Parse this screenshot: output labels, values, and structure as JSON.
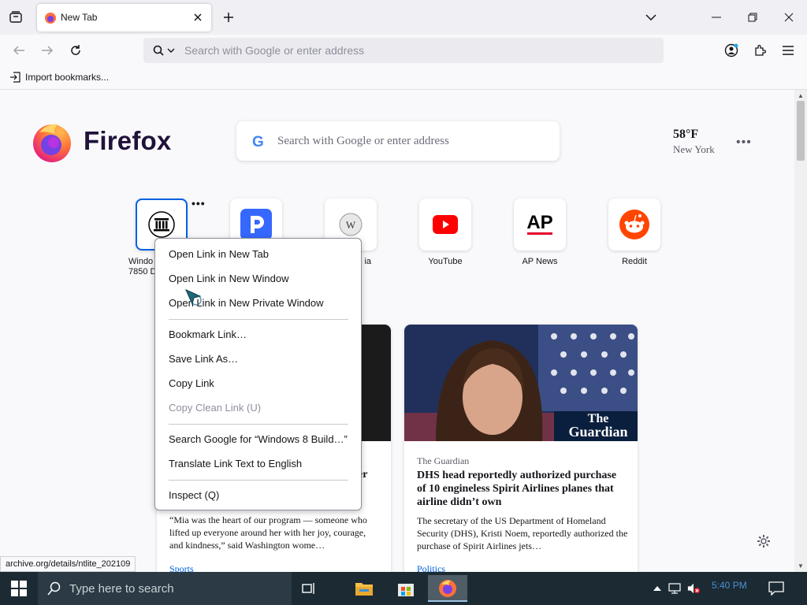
{
  "tab": {
    "title": "New Tab"
  },
  "urlbar": {
    "placeholder": "Search with Google or enter address"
  },
  "bookmarks": {
    "import_label": "Import bookmarks..."
  },
  "newtab": {
    "brand": "Firefox",
    "search_placeholder": "Search with Google or enter address",
    "weather": {
      "temp": "58°F",
      "location": "New York"
    },
    "tiles": [
      {
        "label_line1": "Windo",
        "label_line2": "7850 D",
        "icon": "archive-icon"
      },
      {
        "label": "",
        "icon": "pandora-icon"
      },
      {
        "label": "ia",
        "icon": "wikipedia-icon"
      },
      {
        "label": "YouTube",
        "icon": "youtube-icon"
      },
      {
        "label": "AP News",
        "icon": "ap-news-icon"
      },
      {
        "label": "Reddit",
        "icon": "reddit-icon"
      }
    ],
    "cards": [
      {
        "partial_headline": "er",
        "excerpt": "“Mia was the heart of our program — someone who lifted up everyone around her with her joy, courage, and kindness,” said Washington wome…",
        "tag": "Sports"
      },
      {
        "source": "The Guardian",
        "image_logo_line1": "The",
        "image_logo_line2": "Guardian",
        "headline": "DHS head reportedly authorized purchase of 10 engineless Spirit Airlines planes that airline didn’t own",
        "excerpt": "The secretary of the US Department of Homeland Security (DHS), Kristi Noem, reportedly authorized the purchase of Spirit Airlines jets…",
        "tag": "Politics"
      }
    ]
  },
  "status_url": "archive.org/details/ntlite_202109",
  "context_menu": {
    "items": [
      "Open Link in New Tab",
      "Open Link in New Window",
      "Open Link in New Private Window",
      "Bookmark Link…",
      "Save Link As…",
      "Copy Link",
      "Copy Clean Link (U)",
      "Search Google for “Windows 8 Build…”",
      "Translate Link Text to English",
      "Inspect (Q)"
    ]
  },
  "taskbar": {
    "search_placeholder": "Type here to search",
    "time": "5:40 PM"
  },
  "colors": {
    "accent": "#0061e0",
    "taskbar": "#1c2a33",
    "youtube": "#ff0000",
    "reddit": "#ff4500",
    "ap": "#e4002b"
  }
}
